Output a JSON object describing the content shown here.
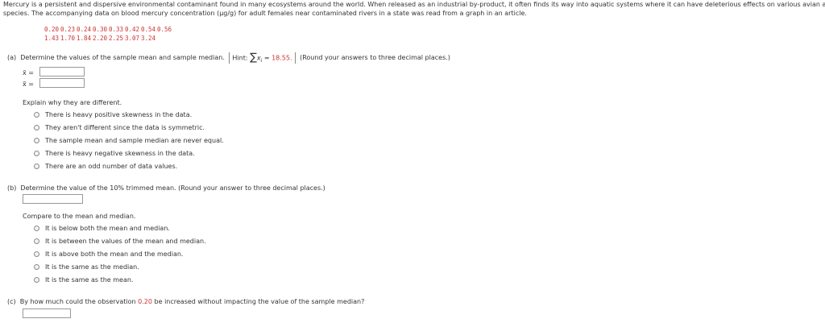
{
  "intro": {
    "line1": "Mercury is a persistent and dispersive environmental contaminant found in many ecosystems around the world. When released as an industrial by-product, it often finds its way into aquatic systems where it can have deleterious effects on various avian and aquatic",
    "line2": "species. The accompanying data on blood mercury concentration (µg/g) for adult females near contaminated rivers in a state was read from a graph in an article."
  },
  "data": {
    "row1": [
      "0.20",
      "0.23",
      "0.24",
      "0.30",
      "0.33",
      "0.42",
      "0.54",
      "0.56"
    ],
    "row2": [
      "1.43",
      "1.70",
      "1.84",
      "2.20",
      "2.25",
      "3.07",
      "3.24"
    ]
  },
  "part_a": {
    "label": "(a)",
    "prompt": "Determine the values of the sample mean and sample median.",
    "hint_label": "Hint:",
    "hint_sum_var": "x",
    "hint_sum_sub": "i",
    "hint_equals": "=",
    "hint_value": "18.55.",
    "round_note": "(Round your answers to three decimal places.)",
    "mean_symbol": "x̄",
    "median_symbol": "x̃",
    "eq": "=",
    "mean_value": "",
    "median_value": "",
    "explain": "Explain why they are different.",
    "options": [
      "There is heavy positive skewness in the data.",
      "They aren't different since the data is symmetric.",
      "The sample mean and sample median are never equal.",
      "There is heavy negative skewness in the data.",
      "There are an odd number of data values."
    ]
  },
  "part_b": {
    "label": "(b)",
    "prompt": "Determine the value of the 10% trimmed mean. (Round your answer to three decimal places.)",
    "answer_value": "",
    "compare": "Compare to the mean and median.",
    "options": [
      "It is below both the mean and median.",
      "It is between the values of the mean and median.",
      "It is above both the mean and the median.",
      "It is the same as the median.",
      "It is the same as the mean."
    ]
  },
  "part_c": {
    "label": "(c)",
    "prompt_before": "By how much could the observation",
    "prompt_value": "0.20",
    "prompt_after": "be increased without impacting the value of the sample median?",
    "answer_value": ""
  }
}
